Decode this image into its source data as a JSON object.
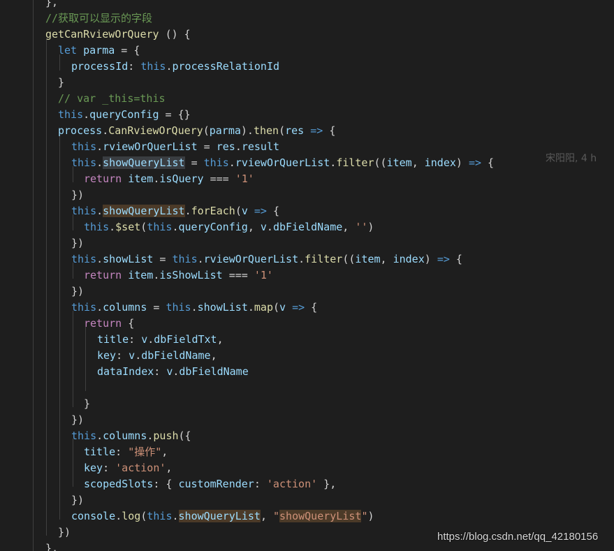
{
  "editor": {
    "lines": [
      [
        {
          "t": "},",
          "c": "pun"
        }
      ],
      [
        {
          "t": "//获取可以显示的字段",
          "c": "cm"
        }
      ],
      [
        {
          "t": "getCanRviewOrQuery",
          "c": "fn"
        },
        {
          "t": " () {",
          "c": "pun"
        }
      ],
      [
        {
          "t": "let",
          "c": "kw"
        },
        {
          "t": " ",
          "c": "pun"
        },
        {
          "t": "parma",
          "c": "prop"
        },
        {
          "t": " = {",
          "c": "pun"
        }
      ],
      [
        {
          "t": "processId",
          "c": "prop"
        },
        {
          "t": ": ",
          "c": "pun"
        },
        {
          "t": "this",
          "c": "kw"
        },
        {
          "t": ".",
          "c": "pun"
        },
        {
          "t": "processRelationId",
          "c": "prop"
        }
      ],
      [
        {
          "t": "}",
          "c": "pun"
        }
      ],
      [
        {
          "t": "// var _this=this",
          "c": "cm"
        }
      ],
      [
        {
          "t": "this",
          "c": "kw"
        },
        {
          "t": ".",
          "c": "pun"
        },
        {
          "t": "queryConfig",
          "c": "prop"
        },
        {
          "t": " = {}",
          "c": "pun"
        }
      ],
      [
        {
          "t": "process",
          "c": "prop"
        },
        {
          "t": ".",
          "c": "pun"
        },
        {
          "t": "CanRviewOrQuery",
          "c": "fn"
        },
        {
          "t": "(",
          "c": "pun"
        },
        {
          "t": "parma",
          "c": "prop"
        },
        {
          "t": ").",
          "c": "pun"
        },
        {
          "t": "then",
          "c": "fn"
        },
        {
          "t": "(",
          "c": "pun"
        },
        {
          "t": "res",
          "c": "prop"
        },
        {
          "t": " ",
          "c": "pun"
        },
        {
          "t": "=>",
          "c": "kw"
        },
        {
          "t": " {",
          "c": "pun"
        }
      ],
      [
        {
          "t": "this",
          "c": "kw"
        },
        {
          "t": ".",
          "c": "pun"
        },
        {
          "t": "rviewOrQuerList",
          "c": "prop"
        },
        {
          "t": " = ",
          "c": "pun"
        },
        {
          "t": "res",
          "c": "prop"
        },
        {
          "t": ".",
          "c": "pun"
        },
        {
          "t": "result",
          "c": "prop"
        }
      ],
      [
        {
          "t": "this",
          "c": "kw"
        },
        {
          "t": ".",
          "c": "pun"
        },
        {
          "t": "showQueryList",
          "c": "prop hl"
        },
        {
          "t": " = ",
          "c": "pun"
        },
        {
          "t": "this",
          "c": "kw"
        },
        {
          "t": ".",
          "c": "pun"
        },
        {
          "t": "rviewOrQuerList",
          "c": "prop"
        },
        {
          "t": ".",
          "c": "pun"
        },
        {
          "t": "filter",
          "c": "fn"
        },
        {
          "t": "((",
          "c": "pun"
        },
        {
          "t": "item",
          "c": "prop"
        },
        {
          "t": ", ",
          "c": "pun"
        },
        {
          "t": "index",
          "c": "prop"
        },
        {
          "t": ") ",
          "c": "pun"
        },
        {
          "t": "=>",
          "c": "kw"
        },
        {
          "t": " {",
          "c": "pun"
        }
      ],
      [
        {
          "t": "return",
          "c": "ctl"
        },
        {
          "t": " ",
          "c": "pun"
        },
        {
          "t": "item",
          "c": "prop"
        },
        {
          "t": ".",
          "c": "pun"
        },
        {
          "t": "isQuery",
          "c": "prop"
        },
        {
          "t": " === ",
          "c": "pun"
        },
        {
          "t": "'1'",
          "c": "str"
        }
      ],
      [
        {
          "t": "})",
          "c": "pun"
        }
      ],
      [
        {
          "t": "this",
          "c": "kw"
        },
        {
          "t": ".",
          "c": "pun"
        },
        {
          "t": "showQueryList",
          "c": "prop hlw"
        },
        {
          "t": ".",
          "c": "pun"
        },
        {
          "t": "forEach",
          "c": "fn"
        },
        {
          "t": "(",
          "c": "pun"
        },
        {
          "t": "v",
          "c": "prop"
        },
        {
          "t": " ",
          "c": "pun"
        },
        {
          "t": "=>",
          "c": "kw"
        },
        {
          "t": " {",
          "c": "pun"
        }
      ],
      [
        {
          "t": "this",
          "c": "kw"
        },
        {
          "t": ".",
          "c": "pun"
        },
        {
          "t": "$set",
          "c": "fn"
        },
        {
          "t": "(",
          "c": "pun"
        },
        {
          "t": "this",
          "c": "kw"
        },
        {
          "t": ".",
          "c": "pun"
        },
        {
          "t": "queryConfig",
          "c": "prop"
        },
        {
          "t": ", ",
          "c": "pun"
        },
        {
          "t": "v",
          "c": "prop"
        },
        {
          "t": ".",
          "c": "pun"
        },
        {
          "t": "dbFieldName",
          "c": "prop"
        },
        {
          "t": ", ",
          "c": "pun"
        },
        {
          "t": "''",
          "c": "str"
        },
        {
          "t": ")",
          "c": "pun"
        }
      ],
      [
        {
          "t": "})",
          "c": "pun"
        }
      ],
      [
        {
          "t": "this",
          "c": "kw"
        },
        {
          "t": ".",
          "c": "pun"
        },
        {
          "t": "showList",
          "c": "prop"
        },
        {
          "t": " = ",
          "c": "pun"
        },
        {
          "t": "this",
          "c": "kw"
        },
        {
          "t": ".",
          "c": "pun"
        },
        {
          "t": "rviewOrQuerList",
          "c": "prop"
        },
        {
          "t": ".",
          "c": "pun"
        },
        {
          "t": "filter",
          "c": "fn"
        },
        {
          "t": "((",
          "c": "pun"
        },
        {
          "t": "item",
          "c": "prop"
        },
        {
          "t": ", ",
          "c": "pun"
        },
        {
          "t": "index",
          "c": "prop"
        },
        {
          "t": ") ",
          "c": "pun"
        },
        {
          "t": "=>",
          "c": "kw"
        },
        {
          "t": " {",
          "c": "pun"
        }
      ],
      [
        {
          "t": "return",
          "c": "ctl"
        },
        {
          "t": " ",
          "c": "pun"
        },
        {
          "t": "item",
          "c": "prop"
        },
        {
          "t": ".",
          "c": "pun"
        },
        {
          "t": "isShowList",
          "c": "prop"
        },
        {
          "t": " === ",
          "c": "pun"
        },
        {
          "t": "'1'",
          "c": "str"
        }
      ],
      [
        {
          "t": "})",
          "c": "pun"
        }
      ],
      [
        {
          "t": "this",
          "c": "kw"
        },
        {
          "t": ".",
          "c": "pun"
        },
        {
          "t": "columns",
          "c": "prop"
        },
        {
          "t": " = ",
          "c": "pun"
        },
        {
          "t": "this",
          "c": "kw"
        },
        {
          "t": ".",
          "c": "pun"
        },
        {
          "t": "showList",
          "c": "prop"
        },
        {
          "t": ".",
          "c": "pun"
        },
        {
          "t": "map",
          "c": "fn"
        },
        {
          "t": "(",
          "c": "pun"
        },
        {
          "t": "v",
          "c": "prop"
        },
        {
          "t": " ",
          "c": "pun"
        },
        {
          "t": "=>",
          "c": "kw"
        },
        {
          "t": " {",
          "c": "pun"
        }
      ],
      [
        {
          "t": "return",
          "c": "ctl"
        },
        {
          "t": " {",
          "c": "pun"
        }
      ],
      [
        {
          "t": "title",
          "c": "prop"
        },
        {
          "t": ": ",
          "c": "pun"
        },
        {
          "t": "v",
          "c": "prop"
        },
        {
          "t": ".",
          "c": "pun"
        },
        {
          "t": "dbFieldTxt",
          "c": "prop"
        },
        {
          "t": ",",
          "c": "pun"
        }
      ],
      [
        {
          "t": "key",
          "c": "prop"
        },
        {
          "t": ": ",
          "c": "pun"
        },
        {
          "t": "v",
          "c": "prop"
        },
        {
          "t": ".",
          "c": "pun"
        },
        {
          "t": "dbFieldName",
          "c": "prop"
        },
        {
          "t": ",",
          "c": "pun"
        }
      ],
      [
        {
          "t": "dataIndex",
          "c": "prop"
        },
        {
          "t": ": ",
          "c": "pun"
        },
        {
          "t": "v",
          "c": "prop"
        },
        {
          "t": ".",
          "c": "pun"
        },
        {
          "t": "dbFieldName",
          "c": "prop"
        }
      ],
      [],
      [
        {
          "t": "}",
          "c": "pun"
        }
      ],
      [
        {
          "t": "})",
          "c": "pun"
        }
      ],
      [
        {
          "t": "this",
          "c": "kw"
        },
        {
          "t": ".",
          "c": "pun"
        },
        {
          "t": "columns",
          "c": "prop"
        },
        {
          "t": ".",
          "c": "pun"
        },
        {
          "t": "push",
          "c": "fn"
        },
        {
          "t": "({",
          "c": "pun"
        }
      ],
      [
        {
          "t": "title",
          "c": "prop"
        },
        {
          "t": ": ",
          "c": "pun"
        },
        {
          "t": "\"操作\"",
          "c": "str"
        },
        {
          "t": ",",
          "c": "pun"
        }
      ],
      [
        {
          "t": "key",
          "c": "prop"
        },
        {
          "t": ": ",
          "c": "pun"
        },
        {
          "t": "'action'",
          "c": "str"
        },
        {
          "t": ",",
          "c": "pun"
        }
      ],
      [
        {
          "t": "scopedSlots",
          "c": "prop"
        },
        {
          "t": ": { ",
          "c": "pun"
        },
        {
          "t": "customRender",
          "c": "prop"
        },
        {
          "t": ": ",
          "c": "pun"
        },
        {
          "t": "'action'",
          "c": "str"
        },
        {
          "t": " },",
          "c": "pun"
        }
      ],
      [
        {
          "t": "})",
          "c": "pun"
        }
      ],
      [
        {
          "t": "console",
          "c": "prop"
        },
        {
          "t": ".",
          "c": "pun"
        },
        {
          "t": "log",
          "c": "fn"
        },
        {
          "t": "(",
          "c": "pun"
        },
        {
          "t": "this",
          "c": "kw"
        },
        {
          "t": ".",
          "c": "pun"
        },
        {
          "t": "showQueryList",
          "c": "prop hlw"
        },
        {
          "t": ", ",
          "c": "pun"
        },
        {
          "t": "\"",
          "c": "str"
        },
        {
          "t": "showQueryList",
          "c": "str hlw"
        },
        {
          "t": "\"",
          "c": "str"
        },
        {
          "t": ")",
          "c": "pun"
        }
      ],
      [
        {
          "t": "})",
          "c": "pun"
        }
      ],
      [
        {
          "t": "},",
          "c": "pun"
        }
      ]
    ],
    "blame": "宋阳阳, 4 h"
  },
  "watermark": "https://blog.csdn.net/qq_42180156"
}
